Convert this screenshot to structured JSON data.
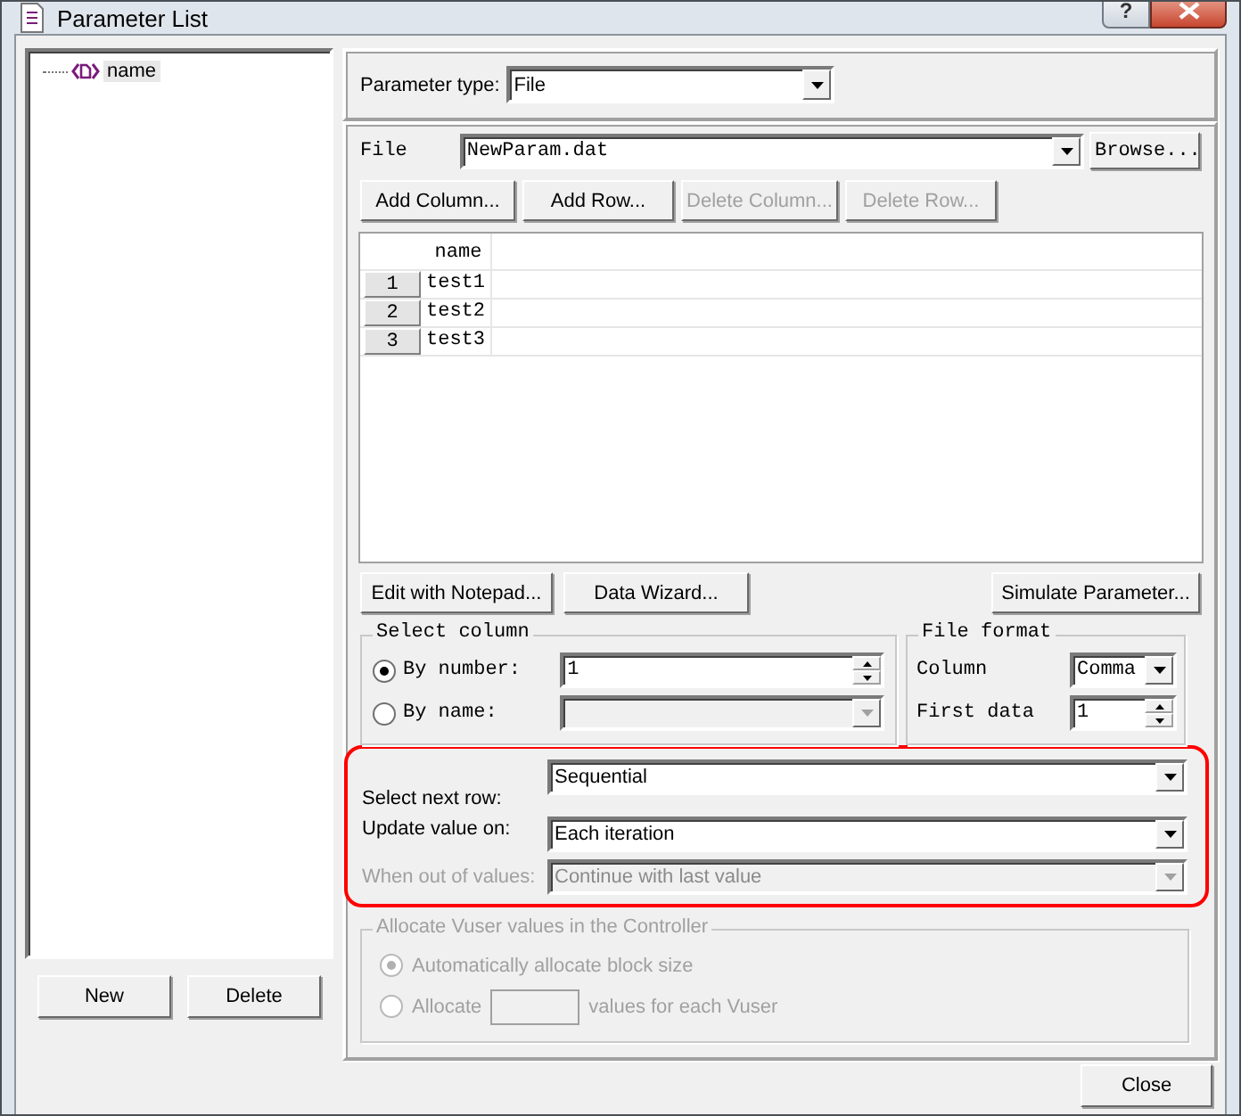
{
  "window": {
    "title": "Parameter List",
    "help": "?"
  },
  "tree": [
    {
      "label": "name",
      "selected": true
    }
  ],
  "left_buttons": [
    "New",
    "Delete"
  ],
  "parameter_type": {
    "label": "Parameter type:",
    "value": "File"
  },
  "file": {
    "label": "File",
    "value": "NewParam.dat",
    "browse": "Browse..."
  },
  "table_buttons": [
    {
      "label": "Add Column...",
      "disabled": false
    },
    {
      "label": "Add Row...",
      "disabled": false
    },
    {
      "label": "Delete Column...",
      "disabled": true
    },
    {
      "label": "Delete Row...",
      "disabled": true
    }
  ],
  "table": {
    "columns": [
      "name"
    ],
    "rows": [
      {
        "number": "1",
        "cells": [
          "test1"
        ]
      },
      {
        "number": "2",
        "cells": [
          "test2"
        ]
      },
      {
        "number": "3",
        "cells": [
          "test3"
        ]
      }
    ]
  },
  "action_buttons": [
    "Edit with Notepad...",
    "Data Wizard...",
    "Simulate Parameter..."
  ],
  "select_column": {
    "title": "Select column",
    "options": [
      {
        "label": "By number:",
        "selected": true,
        "value": "1",
        "disabled": false
      },
      {
        "label": "By name:",
        "selected": false,
        "disabled": true
      }
    ]
  },
  "file_format": {
    "title": "File format",
    "fields": [
      {
        "label": "Column",
        "value": "Comma",
        "kind": "dropdown"
      },
      {
        "label": "First data",
        "value": "1",
        "kind": "spinner"
      }
    ]
  },
  "row_settings": [
    {
      "label": "Select next row:",
      "value": "Sequential",
      "disabled": false
    },
    {
      "label": "Update value on:",
      "value": "Each iteration",
      "disabled": false
    },
    {
      "label": "When out of values:",
      "value": "Continue with last value",
      "disabled": true
    }
  ],
  "allocate": {
    "title": "Allocate Vuser values in the Controller",
    "disabled": true,
    "options": [
      {
        "label": "Automatically allocate block size",
        "selected": true
      },
      {
        "label": "Allocate",
        "selected": false,
        "suffix": "values for each Vuser"
      }
    ]
  },
  "close_button": "Close"
}
